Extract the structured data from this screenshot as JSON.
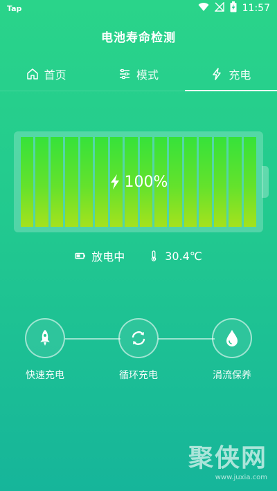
{
  "status_bar": {
    "app_label": "Tap",
    "time": "11:57"
  },
  "title": "电池寿命检测",
  "tabs": [
    {
      "label": "首页",
      "icon": "home-icon",
      "active": false
    },
    {
      "label": "模式",
      "icon": "sliders-icon",
      "active": false
    },
    {
      "label": "充电",
      "icon": "bolt-icon",
      "active": true
    }
  ],
  "battery": {
    "percent_text": "100%",
    "level": 1.0,
    "segments": 16
  },
  "status": {
    "state": "放电中",
    "temperature": "30.4℃"
  },
  "modes": [
    {
      "label": "快速充电",
      "icon": "rocket-icon"
    },
    {
      "label": "循环充电",
      "icon": "cycle-icon"
    },
    {
      "label": "涓流保养",
      "icon": "droplet-icon"
    }
  ],
  "watermark": {
    "text": "聚侠网",
    "url": "www.juxia.com"
  },
  "colors": {
    "bg_top": "#2ad48a",
    "bg_bottom": "#16b59a",
    "cell_top": "#36e23a",
    "cell_bottom": "#a5e21d"
  }
}
